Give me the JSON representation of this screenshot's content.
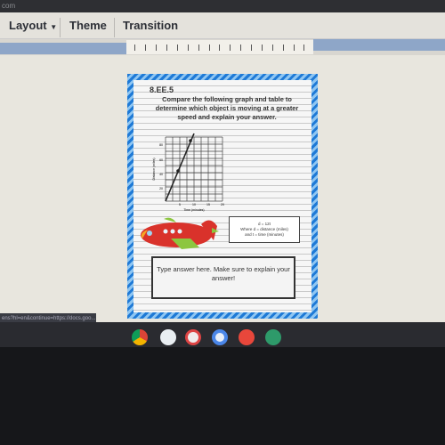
{
  "topbar": {
    "url_fragment": "com"
  },
  "toolbar": {
    "layout_label": "Layout",
    "theme_label": "Theme",
    "transition_label": "Transition"
  },
  "slide": {
    "code": "8.EE.5",
    "prompt": "Compare the following graph and table to determine which object is moving at a greater speed and explain your answer.",
    "graph": {
      "ylabel": "Distance (miles)",
      "xlabel": "Time (minutes)",
      "y_ticks": [
        "20",
        "40",
        "60",
        "80"
      ],
      "x_ticks": [
        "5",
        "10",
        "15",
        "20"
      ]
    },
    "equation": {
      "line1": "d = 12t",
      "line2": "Where d = distance (miles)",
      "line3": "and t = time (minutes)"
    },
    "answer_box": "Type answer here. Make sure to explain your answer!"
  },
  "status_url": "ens?hl=en&continue=https://docs.goo...",
  "shelf": {
    "apps": [
      "chrome-icon",
      "play-store-icon",
      "gmail-icon",
      "docs-icon",
      "youtube-icon",
      "classroom-icon"
    ]
  },
  "colors": {
    "border_blue": "#1f7ad6",
    "plane_red": "#d9322b",
    "plane_green": "#8cc63f"
  }
}
